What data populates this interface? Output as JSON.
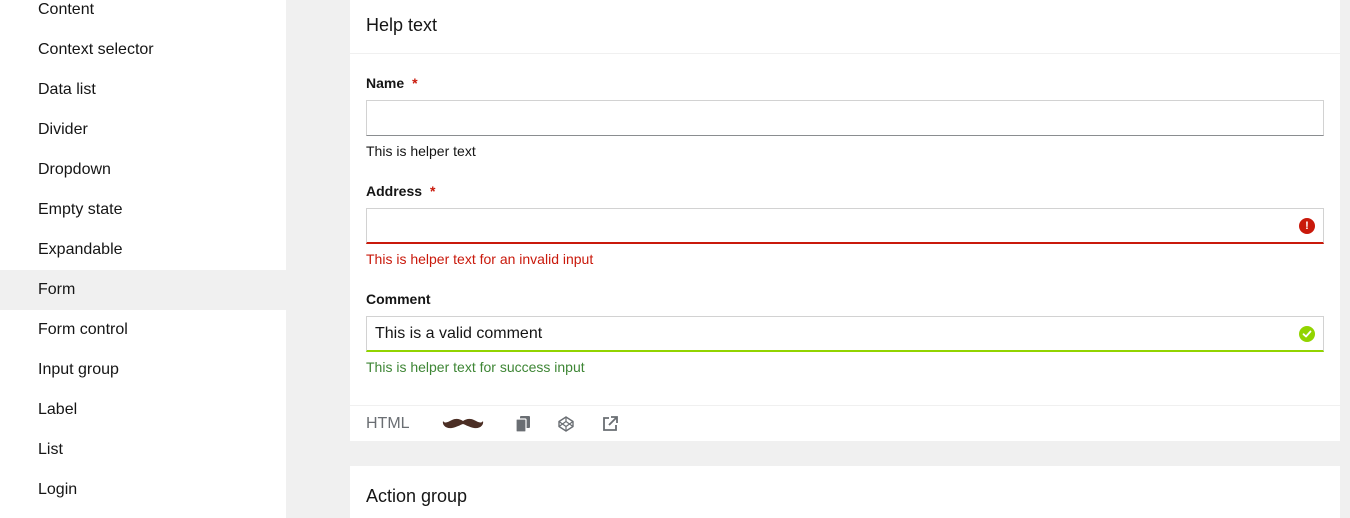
{
  "sidebar": {
    "items": [
      {
        "label": "Content",
        "active": false
      },
      {
        "label": "Context selector",
        "active": false
      },
      {
        "label": "Data list",
        "active": false
      },
      {
        "label": "Divider",
        "active": false
      },
      {
        "label": "Dropdown",
        "active": false
      },
      {
        "label": "Empty state",
        "active": false
      },
      {
        "label": "Expandable",
        "active": false
      },
      {
        "label": "Form",
        "active": true
      },
      {
        "label": "Form control",
        "active": false
      },
      {
        "label": "Input group",
        "active": false
      },
      {
        "label": "Label",
        "active": false
      },
      {
        "label": "List",
        "active": false
      },
      {
        "label": "Login",
        "active": false
      }
    ]
  },
  "help_card": {
    "title": "Help text",
    "fields": {
      "name": {
        "label": "Name",
        "required_mark": "*",
        "value": "",
        "helper": "This is helper text"
      },
      "address": {
        "label": "Address",
        "required_mark": "*",
        "value": "",
        "helper": "This is helper text for an invalid input",
        "status": "error"
      },
      "comment": {
        "label": "Comment",
        "value": "This is a valid comment",
        "helper": "This is helper text for success input",
        "status": "success"
      }
    },
    "toolbar": {
      "html_label": "HTML",
      "icons": [
        "mustache-icon",
        "copy-icon",
        "codepen-icon",
        "external-link-icon"
      ]
    }
  },
  "action_card": {
    "title": "Action group"
  },
  "colors": {
    "error": "#c9190b",
    "success": "#3e8635",
    "success_border": "#92d400",
    "active_nav_bg": "#f0f0f0"
  }
}
